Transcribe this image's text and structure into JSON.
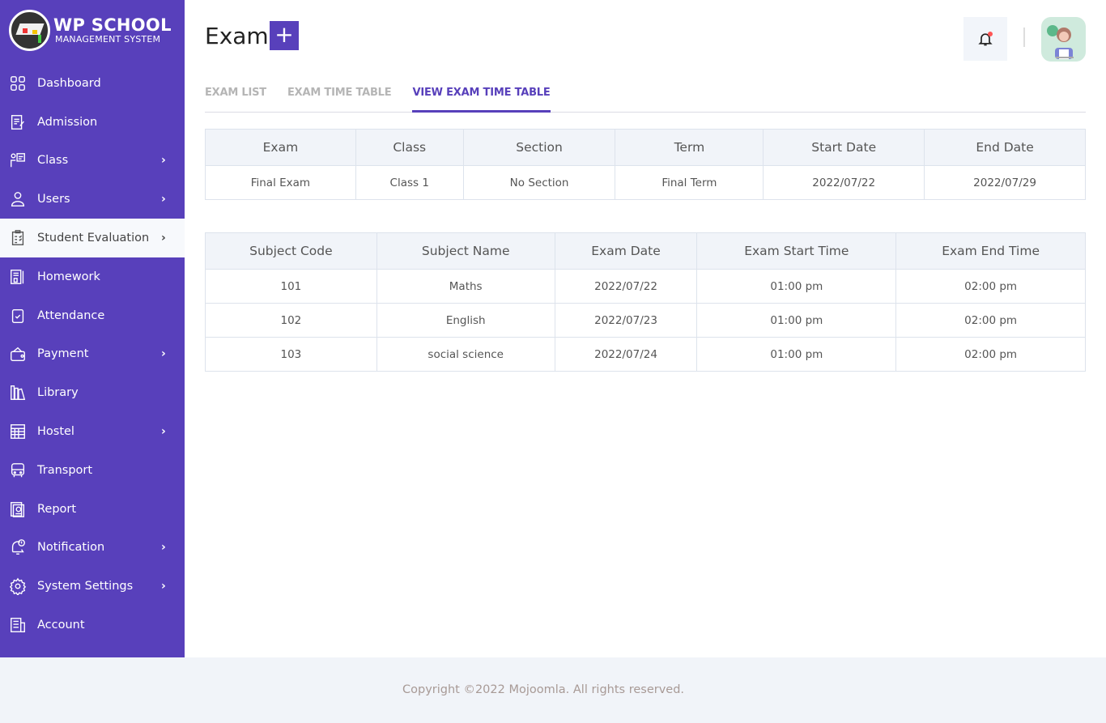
{
  "brand": {
    "line1": "WP SCHOOL",
    "line2": "MANAGEMENT SYSTEM"
  },
  "sidebar": {
    "items": [
      {
        "label": "Dashboard",
        "icon": "dashboard-grid-icon",
        "has_submenu": false,
        "active": false
      },
      {
        "label": "Admission",
        "icon": "admission-form-icon",
        "has_submenu": false,
        "active": false
      },
      {
        "label": "Class",
        "icon": "class-teacher-icon",
        "has_submenu": true,
        "active": false
      },
      {
        "label": "Users",
        "icon": "user-icon",
        "has_submenu": true,
        "active": false
      },
      {
        "label": "Student Evaluation",
        "icon": "clipboard-checklist-icon",
        "has_submenu": true,
        "active": true
      },
      {
        "label": "Homework",
        "icon": "homework-notebook-icon",
        "has_submenu": false,
        "active": false
      },
      {
        "label": "Attendance",
        "icon": "attendance-check-icon",
        "has_submenu": false,
        "active": false
      },
      {
        "label": "Payment",
        "icon": "wallet-icon",
        "has_submenu": true,
        "active": false
      },
      {
        "label": "Library",
        "icon": "library-books-icon",
        "has_submenu": false,
        "active": false
      },
      {
        "label": "Hostel",
        "icon": "hostel-building-icon",
        "has_submenu": true,
        "active": false
      },
      {
        "label": "Transport",
        "icon": "bus-icon",
        "has_submenu": false,
        "active": false
      },
      {
        "label": "Report",
        "icon": "report-icon",
        "has_submenu": false,
        "active": false
      },
      {
        "label": "Notification",
        "icon": "notification-bell-icon",
        "has_submenu": true,
        "active": false
      },
      {
        "label": "System Settings",
        "icon": "gear-icon",
        "has_submenu": true,
        "active": false
      },
      {
        "label": "Account",
        "icon": "account-building-icon",
        "has_submenu": false,
        "active": false
      }
    ],
    "chevron": "›"
  },
  "header": {
    "title": "Exam",
    "add_label": "+"
  },
  "tabs": [
    {
      "label": "EXAM LIST",
      "active": false
    },
    {
      "label": "EXAM TIME TABLE",
      "active": false
    },
    {
      "label": "VIEW EXAM TIME TABLE",
      "active": true
    }
  ],
  "exam_table": {
    "headers": [
      "Exam",
      "Class",
      "Section",
      "Term",
      "Start Date",
      "End Date"
    ],
    "rows": [
      [
        "Final Exam",
        "Class 1",
        "No Section",
        "Final Term",
        "2022/07/22",
        "2022/07/29"
      ]
    ]
  },
  "schedule_table": {
    "headers": [
      "Subject Code",
      "Subject Name",
      "Exam Date",
      "Exam Start Time",
      "Exam End Time"
    ],
    "rows": [
      [
        "101",
        "Maths",
        "2022/07/22",
        "01:00 pm",
        "02:00 pm"
      ],
      [
        "102",
        "English",
        "2022/07/23",
        "01:00 pm",
        "02:00 pm"
      ],
      [
        "103",
        "social science",
        "2022/07/24",
        "01:00 pm",
        "02:00 pm"
      ]
    ]
  },
  "footer": {
    "text": "Copyright ©2022 Mojoomla. All rights reserved."
  },
  "colors": {
    "brand": "#5840bb",
    "active_bg": "#f7f9fc",
    "header_bg": "#f1f4f9",
    "notification_dot": "#ff5555"
  }
}
